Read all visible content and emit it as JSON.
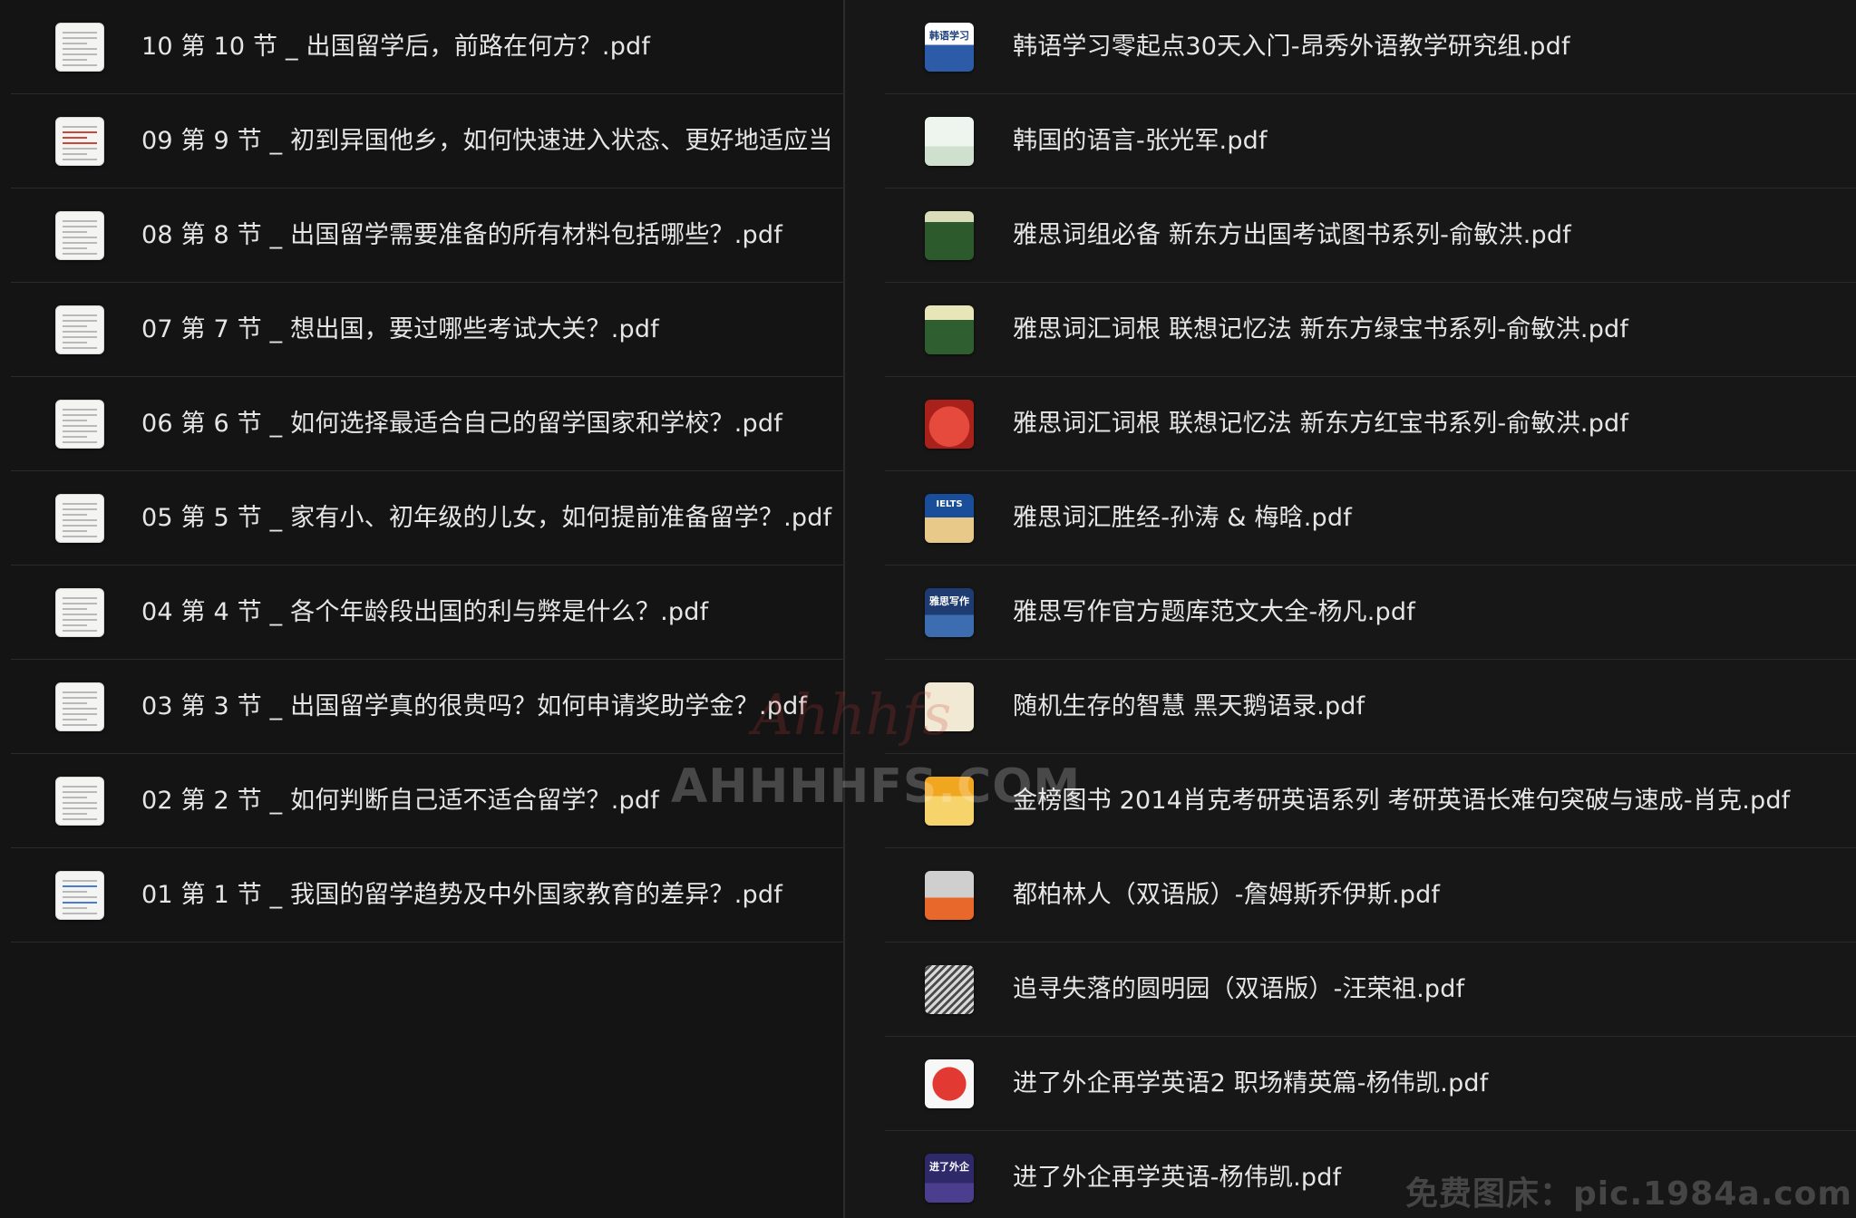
{
  "left_pane": {
    "files": [
      {
        "name": "10 第 10 节 _ 出国留学后，前路在何方？.pdf",
        "thumb": "doc"
      },
      {
        "name": "09 第 9 节 _ 初到异国他乡，如何快速进入状态、更好地适应当",
        "thumb": "doc-red"
      },
      {
        "name": "08 第 8 节 _ 出国留学需要准备的所有材料包括哪些？.pdf",
        "thumb": "doc"
      },
      {
        "name": "07 第 7 节 _ 想出国，要过哪些考试大关？.pdf",
        "thumb": "doc"
      },
      {
        "name": "06 第 6 节 _ 如何选择最适合自己的留学国家和学校？.pdf",
        "thumb": "doc"
      },
      {
        "name": "05 第 5 节 _ 家有小、初年级的儿女，如何提前准备留学？.pdf",
        "thumb": "doc"
      },
      {
        "name": "04 第 4 节 _ 各个年龄段出国的利与弊是什么？.pdf",
        "thumb": "doc"
      },
      {
        "name": "03 第 3 节 _ 出国留学真的很贵吗？如何申请奖助学金？.pdf",
        "thumb": "doc"
      },
      {
        "name": "02 第 2 节 _ 如何判断自己适不适合留学？.pdf",
        "thumb": "doc"
      },
      {
        "name": "01 第 1 节 _ 我国的留学趋势及中外国家教育的差异？.pdf",
        "thumb": "doc-blue"
      }
    ]
  },
  "right_pane": {
    "files": [
      {
        "name": "韩语学习零起点30天入门-昂秀外语教学研究组.pdf",
        "thumb": "cover-blueword",
        "cover_text": "韩语学习"
      },
      {
        "name": "韩国的语言-张光军.pdf",
        "thumb": "cover-mint",
        "cover_text": ""
      },
      {
        "name": "雅思词组必备 新东方出国考试图书系列-俞敏洪.pdf",
        "thumb": "cover-green",
        "cover_text": ""
      },
      {
        "name": "雅思词汇词根 联想记忆法 新东方绿宝书系列-俞敏洪.pdf",
        "thumb": "cover-green2",
        "cover_text": ""
      },
      {
        "name": "雅思词汇词根 联想记忆法 新东方红宝书系列-俞敏洪.pdf",
        "thumb": "cover-red",
        "cover_text": ""
      },
      {
        "name": "雅思词汇胜经-孙涛 & 梅晗.pdf",
        "thumb": "cover-ielts",
        "cover_text": "IELTS"
      },
      {
        "name": "雅思写作官方题库范文大全-杨凡.pdf",
        "thumb": "cover-navy",
        "cover_text": "雅思写作"
      },
      {
        "name": "随机生存的智慧 黑天鹅语录.pdf",
        "thumb": "cover-cream",
        "cover_text": ""
      },
      {
        "name": "金榜图书 2014肖克考研英语系列 考研英语长难句突破与速成-肖克.pdf",
        "thumb": "cover-yellow",
        "cover_text": ""
      },
      {
        "name": "都柏林人（双语版）-詹姆斯乔伊斯.pdf",
        "thumb": "cover-orange",
        "cover_text": ""
      },
      {
        "name": "追寻失落的圆明园（双语版）-汪荣祖.pdf",
        "thumb": "cover-sketch",
        "cover_text": ""
      },
      {
        "name": "进了外企再学英语2 职场精英篇-杨伟凯.pdf",
        "thumb": "cover-redwhite",
        "cover_text": ""
      },
      {
        "name": "进了外企再学英语-杨伟凯.pdf",
        "thumb": "cover-purple",
        "cover_text": "进了外企"
      }
    ]
  },
  "watermarks": {
    "center": "AHHHHFS.COM",
    "script": "Ahhhfs",
    "corner": "免费图床：pic.1984a.com"
  }
}
